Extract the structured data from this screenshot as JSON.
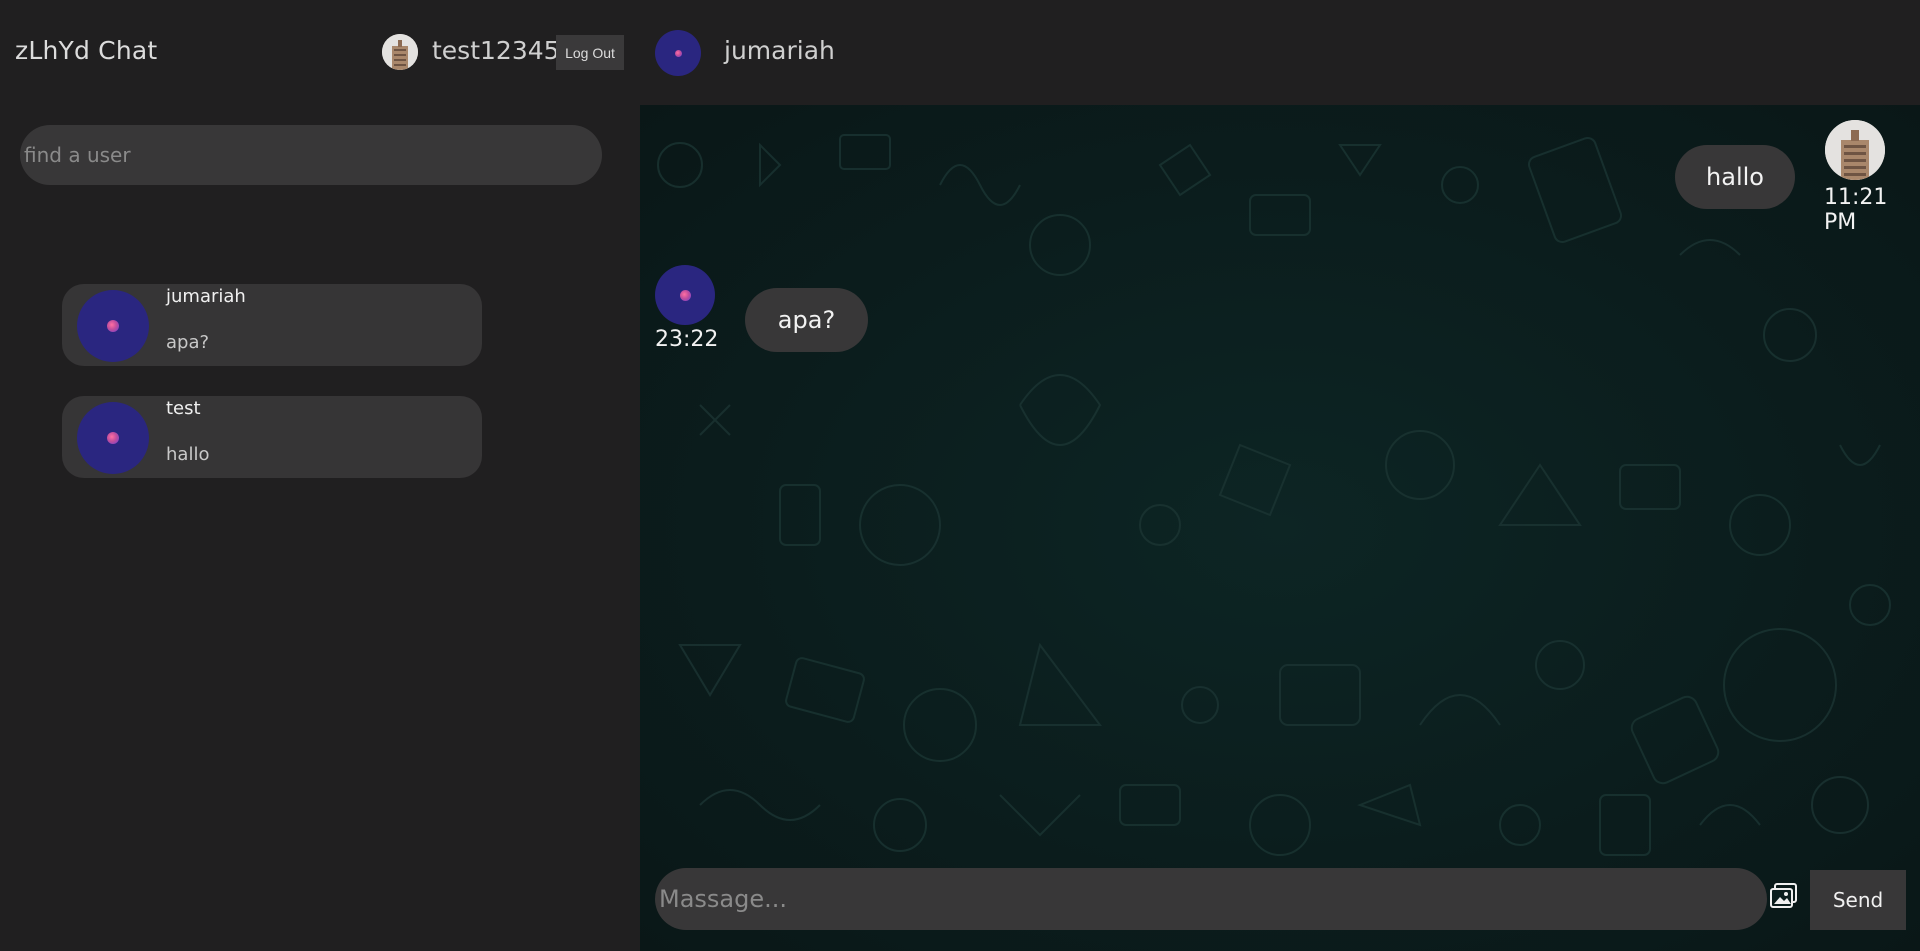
{
  "app": {
    "title": "zLhYd Chat"
  },
  "current_user": {
    "name": "test12345",
    "logout_label": "Log Out"
  },
  "search": {
    "placeholder": "find a user"
  },
  "contacts": [
    {
      "name": "jumariah",
      "last_message": "apa?"
    },
    {
      "name": "test",
      "last_message": "hallo"
    }
  ],
  "chat": {
    "peer_name": "jumariah",
    "messages": [
      {
        "direction": "outgoing",
        "text": "hallo",
        "time": "11:21 PM"
      },
      {
        "direction": "incoming",
        "text": "apa?",
        "time": "23:22"
      }
    ]
  },
  "composer": {
    "placeholder": "Massage...",
    "send_label": "Send",
    "attach_icon": "image-icon"
  },
  "colors": {
    "background": "#201f20",
    "panel": "#383738",
    "chat_background": "#0b1d1d",
    "avatar_blue": "#2a2680"
  }
}
